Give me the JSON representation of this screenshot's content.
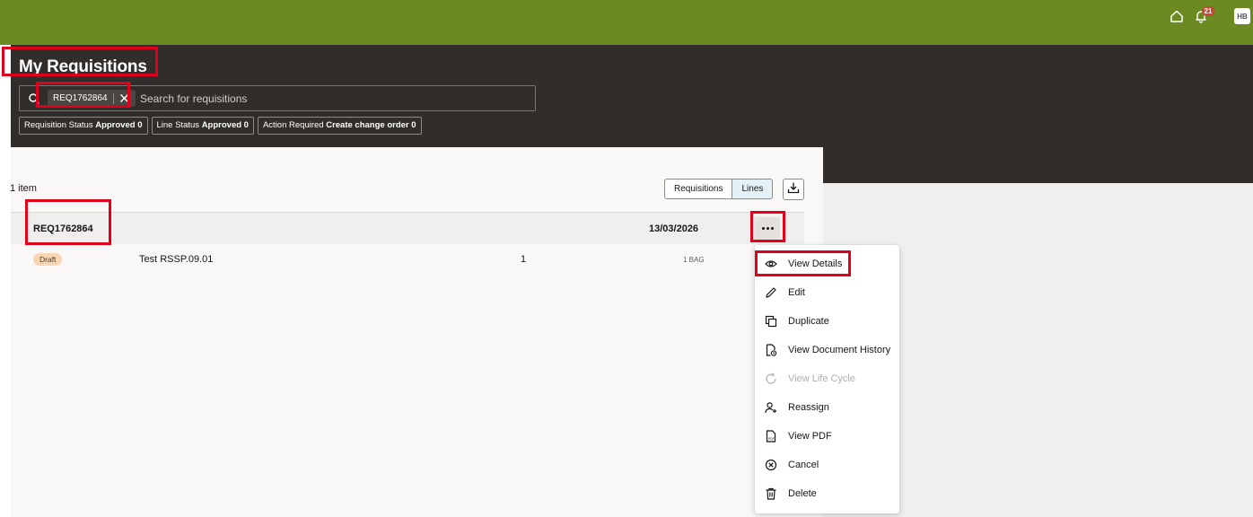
{
  "topbar": {
    "notification_count": "21",
    "user_initials": "HB",
    "accent_color": "#6b8a22"
  },
  "header": {
    "title": "My Requisitions"
  },
  "search": {
    "chip_value": "REQ1762864",
    "placeholder": "Search for requisitions"
  },
  "filters": [
    {
      "label": "Requisition Status",
      "value": "Approved",
      "count": "0"
    },
    {
      "label": "Line Status",
      "value": "Approved",
      "count": "0"
    },
    {
      "label": "Action Required",
      "value": "Create change order",
      "count": "0"
    }
  ],
  "results": {
    "count_text": "1 item",
    "view_toggle": [
      "Requisitions",
      "Lines"
    ],
    "active_view": "Lines"
  },
  "requisition": {
    "number": "REQ1762864",
    "date": "13/03/2026",
    "line": {
      "status": "Draft",
      "description": "Test RSSP.09.01",
      "quantity": "1",
      "uom": "1 BAG"
    }
  },
  "menu": {
    "items": [
      {
        "label": "View Details",
        "icon": "eye-icon",
        "enabled": true
      },
      {
        "label": "Edit",
        "icon": "pencil-icon",
        "enabled": true
      },
      {
        "label": "Duplicate",
        "icon": "duplicate-icon",
        "enabled": true
      },
      {
        "label": "View Document History",
        "icon": "document-history-icon",
        "enabled": true
      },
      {
        "label": "View Life Cycle",
        "icon": "life-cycle-icon",
        "enabled": false
      },
      {
        "label": "Reassign",
        "icon": "reassign-user-icon",
        "enabled": true
      },
      {
        "label": "View PDF",
        "icon": "pdf-icon",
        "enabled": true
      },
      {
        "label": "Cancel",
        "icon": "cancel-circle-icon",
        "enabled": true
      },
      {
        "label": "Delete",
        "icon": "trash-icon",
        "enabled": true
      }
    ]
  }
}
